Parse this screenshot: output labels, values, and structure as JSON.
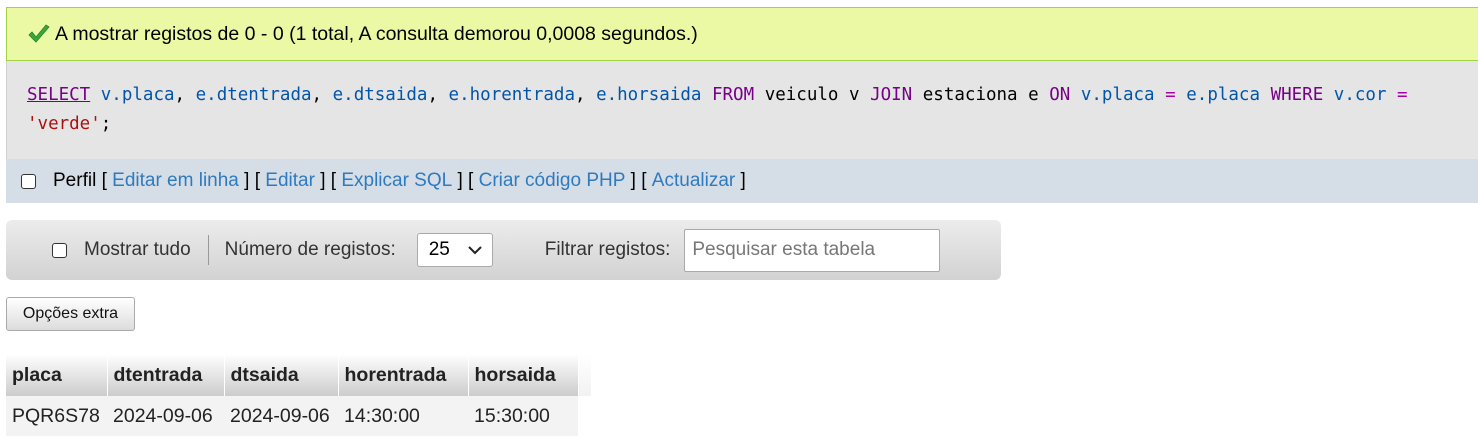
{
  "success_message": "A mostrar registos de 0 - 0 (1 total, A consulta demorou 0,0008 segundos.)",
  "sql": {
    "select": "SELECT",
    "cols": [
      "v.placa",
      "e.dtentrada",
      "e.dtsaida",
      "e.horentrada",
      "e.horsaida"
    ],
    "from": "FROM",
    "table1": "veiculo v",
    "join": "JOIN",
    "table2": "estaciona e",
    "on": "ON",
    "on_left": "v.placa",
    "eq": "=",
    "on_right": "e.placa",
    "where": "WHERE",
    "where_col": "v.cor",
    "where_val": "'verde'"
  },
  "query_tools": {
    "profile_label": "Perfil",
    "inline_edit": "Editar em linha",
    "edit": "Editar",
    "explain": "Explicar SQL",
    "php_code": "Criar código PHP",
    "refresh": "Actualizar"
  },
  "nav": {
    "show_all_label": "Mostrar tudo",
    "rows_label": "Número de registos:",
    "rows_value": "25",
    "filter_label": "Filtrar registos:",
    "search_placeholder": "Pesquisar esta tabela"
  },
  "extra_options_label": "Opções extra",
  "results": {
    "columns": [
      "placa",
      "dtentrada",
      "dtsaida",
      "horentrada",
      "horsaida"
    ],
    "rows": [
      [
        "PQR6S78",
        "2024-09-06",
        "2024-09-06",
        "14:30:00",
        "15:30:00"
      ]
    ]
  },
  "colors": {
    "success_bg": "#ebf8a4",
    "link": "#2f7abf",
    "keyword": "#770088",
    "column": "#0055aa",
    "string": "#aa1111"
  }
}
